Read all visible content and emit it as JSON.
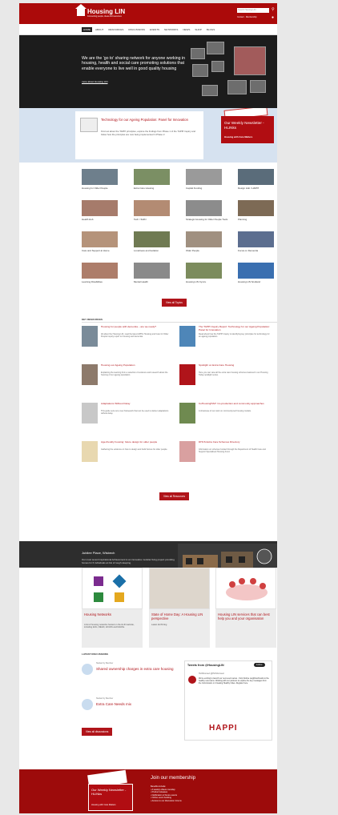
{
  "header": {
    "logo_text": "Housing LIN",
    "logo_tagline": "Connecting people, ideas and resources",
    "search_placeholder": "Search Housing LIN",
    "links": "Contact · Membership",
    "search_icon": "search-icon",
    "user_icon": "user-icon"
  },
  "nav": {
    "items": [
      "Home",
      "About",
      "Resources",
      "Discussions",
      "Events",
      "Networks",
      "News",
      "Shop",
      "Blogs"
    ]
  },
  "hero": {
    "tagline": "We are the 'go to' sharing network for anyone working in housing, health and social care promoting solutions that enable everyone to live well in good quality housing",
    "link": "more about Housing LIN"
  },
  "featured": {
    "title": "Technology for our Ageing Population: Panel for Innovation",
    "text": "Find out about the TAPPI principles, explore the findings from Phase 1 of the TAPPI Inquiry and follow how the principles are now being implemented in Phase 2.",
    "newsletter_title": "Our Weekly Newsletter - HLINks",
    "newsletter_sub": "Housing with Care Matters"
  },
  "topics": {
    "items": [
      {
        "label": "Housing for Older People",
        "color": "#6e7f8c"
      },
      {
        "label": "Extra Care Housing",
        "color": "#7b8f64"
      },
      {
        "label": "Capital Funding",
        "color": "#9a9a9a"
      },
      {
        "label": "Design Hub / HAPPI",
        "color": "#5a6c7a"
      },
      {
        "label": "Health Hub",
        "color": "#a67b6b"
      },
      {
        "label": "Tech / SHIN",
        "color": "#b38b73"
      },
      {
        "label": "Strategic Housing for Older People Tools",
        "color": "#8c8c8c"
      },
      {
        "label": "Planning",
        "color": "#7d6a55"
      },
      {
        "label": "Care and Support at Home",
        "color": "#b5937a"
      },
      {
        "label": "Loneliness and Isolation",
        "color": "#6f7a52"
      },
      {
        "label": "Older People",
        "color": "#a09080"
      },
      {
        "label": "Focus on Dementia",
        "color": "#5c6e8f"
      },
      {
        "label": "Learning Disabilities",
        "color": "#ad7d6a"
      },
      {
        "label": "Mental Health",
        "color": "#8a8a8a"
      },
      {
        "label": "Housing LIN Cymru",
        "color": "#7c8c5d"
      },
      {
        "label": "Housing LIN Scotland",
        "color": "#3a6fb0"
      }
    ],
    "button": "View all Topics"
  },
  "resources": {
    "heading": "KEY RESOURCES",
    "items": [
      {
        "title": "Housing for people with dementia – are we ready?",
        "desc": "All about the Housing LIN, read the latest APPG Housing and Care for Older People Inquiry report on housing and dementia.",
        "color": "#7a8b99"
      },
      {
        "title": "The TAPPI Inquiry Report: Technology for our Ageing Population: Panel for Innovation",
        "desc": "Read about how the TAPPI Inquiry is identifying key principles for technology for an ageing population.",
        "color": "#4e86b8"
      },
      {
        "title": "Housing our Ageing Population",
        "desc": "Explaining the learning from a selection of evidence and research about the housing of our ageing population.",
        "color": "#8d7a6b"
      },
      {
        "title": "Spotlight on Extra Care Housing",
        "desc": "Here you can view all the extra care housing schemes featured in our Housing Today spotlight series.",
        "color": "#b0141a"
      },
      {
        "title": "Adaptations Without Delay",
        "desc": "This guide sets out a new framework that can be used to deliver adaptations without delay.",
        "color": "#c8c8c8"
      },
      {
        "title": "CoHousingHAP: Co-production and community approaches",
        "desc": "A showcase of our work on community-led housing models.",
        "color": "#6f8a50"
      },
      {
        "title": "Age-friendly housing: future design for older people",
        "desc": "Gathering the evidence on how to design and build homes for older people.",
        "color": "#e8d8b0"
      },
      {
        "title": "DHCS Extra Care Schemes Directory",
        "desc": "Information on schemes funded through the Department of Health Care and Support Specialised Housing Fund.",
        "color": "#d9a0a0"
      }
    ],
    "button": "View all Resources"
  },
  "jubilee": {
    "title": "Jubilee Place, Wisbech",
    "desc": "Our most recent Inspirational Achievement is an innovative modular living project providing homes for 6 individuals at risk of rough sleeping."
  },
  "cards": [
    {
      "title": "Housing Networks",
      "desc": "A list of housing networks hosted on the HLIN website, including ECG, DEHN, HOLNS and DAHNs."
    },
    {
      "title": "State of Home Day: A Housing LIN perspective",
      "desc": "Latest HLIN blog"
    },
    {
      "title": "Housing LIN services that can best help you and your organisation",
      "desc": ""
    }
  ],
  "discussions": {
    "heading": "LATEST DISCUSSIONS",
    "items": [
      {
        "meta": "Started by Member",
        "title": "Shared ownership charges in extra care housing"
      },
      {
        "meta": "Started by Member",
        "title": "Extra Care Needs mix"
      }
    ],
    "button": "View all discussions"
  },
  "tweets": {
    "title": "Tweets from @HousingLIN",
    "follow": "Follow",
    "author": "HLINConnect @HLINConnect",
    "body": "We're exciting to launch our next event series - from lifetime neighbourhoods to the healthy new towns. Working with our partners to explore the key messages from the Commission on Creating Healthy Cities. Register here.",
    "image_text": "HAPPI"
  },
  "footer": {
    "newsletter_title": "Our Weekly Newsletter - HLINks",
    "newsletter_sub": "Housing with Care Matters",
    "join_title": "Join our membership",
    "benefits": [
      "Benefits include:",
      "• A weekly eNews roundup",
      "• Product releases",
      "• Notification of future events",
      "• Online event booking",
      "• Access to our discussion forums"
    ]
  }
}
